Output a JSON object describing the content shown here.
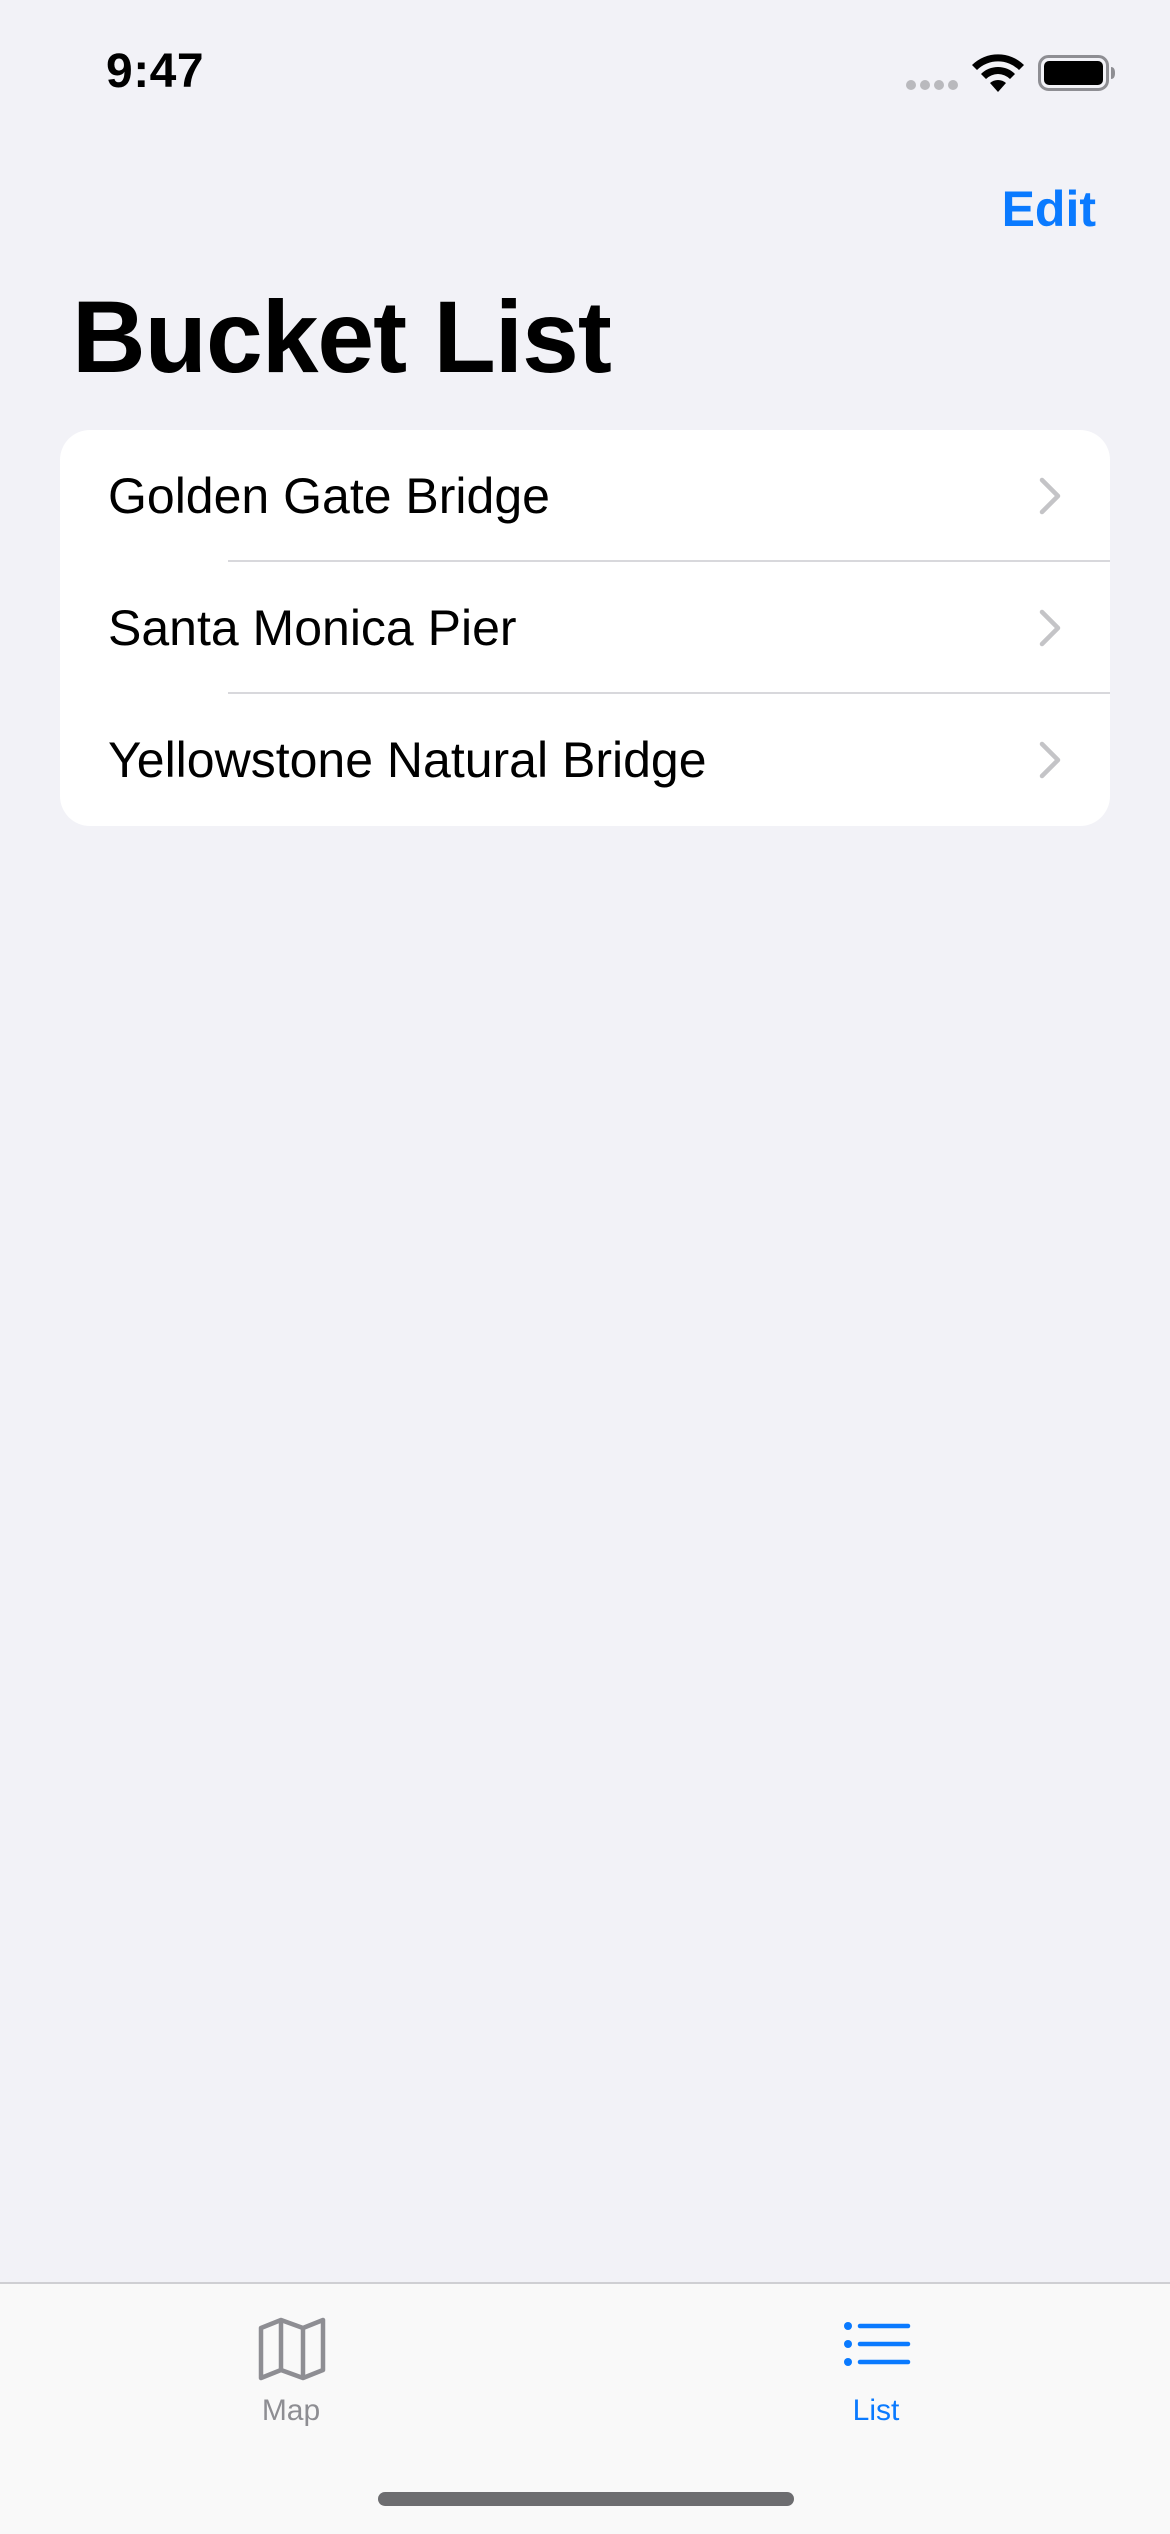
{
  "status_bar": {
    "time": "9:47"
  },
  "nav": {
    "edit_label": "Edit",
    "title": "Bucket List"
  },
  "list": {
    "items": [
      {
        "label": "Golden Gate Bridge"
      },
      {
        "label": "Santa Monica Pier"
      },
      {
        "label": "Yellowstone Natural Bridge"
      }
    ]
  },
  "tab_bar": {
    "tabs": [
      {
        "label": "Map",
        "icon": "map-icon",
        "selected": false
      },
      {
        "label": "List",
        "icon": "list-icon",
        "selected": true
      }
    ]
  },
  "colors": {
    "accent": "#0a7aff",
    "background": "#f2f2f7",
    "card": "#ffffff",
    "inactive_tab": "#8e8e93"
  }
}
